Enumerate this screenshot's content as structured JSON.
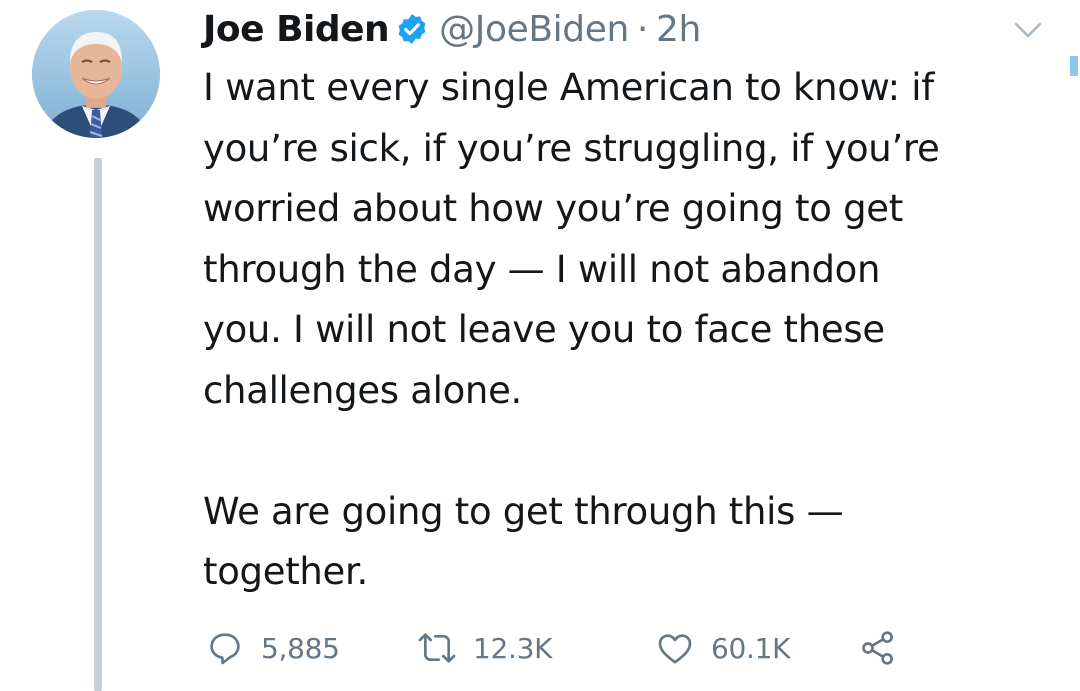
{
  "author": {
    "display_name": "Joe Biden",
    "handle": "@JoeBiden",
    "separator": "·",
    "time": "2h",
    "verified": true
  },
  "tweet": {
    "lines_1": [
      "I want every single American to know: if",
      "you’re sick, if you’re struggling, if you’re",
      "worried about how you’re going to get",
      "through the day — I will not abandon",
      "you. I will not leave you to face these",
      "challenges alone."
    ],
    "lines_2": [
      "We are going to get through this —",
      "together."
    ]
  },
  "actions": {
    "reply_count": "5,885",
    "retweet_count": "12.3K",
    "like_count": "60.1K"
  },
  "colors": {
    "text": "#14171a",
    "secondary": "#657786",
    "verified": "#1da1f2",
    "thread_line": "#c4cfd6"
  },
  "icons": {
    "avatar": "avatar",
    "verified": "verified-badge-icon",
    "more": "chevron-down-icon",
    "reply": "reply-icon",
    "retweet": "retweet-icon",
    "like": "heart-icon",
    "share": "share-icon"
  }
}
